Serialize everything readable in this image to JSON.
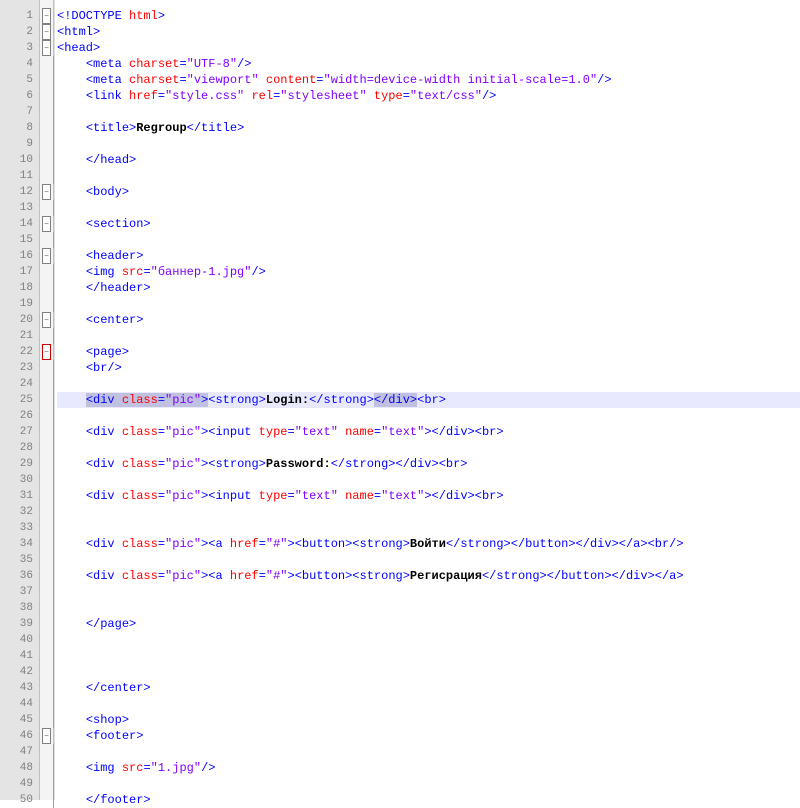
{
  "tabs": {
    "active": "..."
  },
  "gutter": {
    "start": 1,
    "end": 50
  },
  "foldMarkers": {
    "1": "minus",
    "2": "minus",
    "3": "minus",
    "12": "minus",
    "14": "minus",
    "16": "minus",
    "20": "minus",
    "22": "minus-red",
    "46": "minus"
  },
  "code": {
    "1": {
      "indent": 0,
      "tokens": [
        {
          "t": "tag",
          "v": "<!DOCTYPE "
        },
        {
          "t": "attr",
          "v": "html"
        },
        {
          "t": "tag",
          "v": ">"
        }
      ]
    },
    "2": {
      "indent": 0,
      "tokens": [
        {
          "t": "tag",
          "v": "<html>"
        }
      ]
    },
    "3": {
      "indent": 0,
      "tokens": [
        {
          "t": "tag",
          "v": "<head>"
        }
      ]
    },
    "4": {
      "indent": 1,
      "tokens": [
        {
          "t": "tag",
          "v": "<meta "
        },
        {
          "t": "attr",
          "v": "charset"
        },
        {
          "t": "tag",
          "v": "="
        },
        {
          "t": "val",
          "v": "\"UTF-8\""
        },
        {
          "t": "tag",
          "v": "/>"
        }
      ]
    },
    "5": {
      "indent": 1,
      "tokens": [
        {
          "t": "tag",
          "v": "<meta "
        },
        {
          "t": "attr",
          "v": "charset"
        },
        {
          "t": "tag",
          "v": "="
        },
        {
          "t": "val",
          "v": "\"viewport\""
        },
        {
          "t": "tag",
          "v": " "
        },
        {
          "t": "attr",
          "v": "content"
        },
        {
          "t": "tag",
          "v": "="
        },
        {
          "t": "val",
          "v": "\"width=device-width initial-scale=1.0\""
        },
        {
          "t": "tag",
          "v": "/>"
        }
      ]
    },
    "6": {
      "indent": 1,
      "tokens": [
        {
          "t": "tag",
          "v": "<link "
        },
        {
          "t": "attr",
          "v": "href"
        },
        {
          "t": "tag",
          "v": "="
        },
        {
          "t": "val",
          "v": "\"style.css\""
        },
        {
          "t": "tag",
          "v": " "
        },
        {
          "t": "attr",
          "v": "rel"
        },
        {
          "t": "tag",
          "v": "="
        },
        {
          "t": "val",
          "v": "\"stylesheet\""
        },
        {
          "t": "tag",
          "v": " "
        },
        {
          "t": "attr",
          "v": "type"
        },
        {
          "t": "tag",
          "v": "="
        },
        {
          "t": "val",
          "v": "\"text/css\""
        },
        {
          "t": "tag",
          "v": "/>"
        }
      ]
    },
    "7": {
      "indent": 1,
      "tokens": []
    },
    "8": {
      "indent": 1,
      "tokens": [
        {
          "t": "tag",
          "v": "<title>"
        },
        {
          "t": "txt",
          "v": "Regroup"
        },
        {
          "t": "tag",
          "v": "</title>"
        }
      ]
    },
    "9": {
      "indent": 1,
      "tokens": []
    },
    "10": {
      "indent": 1,
      "tokens": [
        {
          "t": "tag",
          "v": "</head>"
        }
      ]
    },
    "11": {
      "indent": 1,
      "tokens": []
    },
    "12": {
      "indent": 1,
      "tokens": [
        {
          "t": "tag",
          "v": "<body>"
        }
      ]
    },
    "13": {
      "indent": 1,
      "tokens": []
    },
    "14": {
      "indent": 1,
      "tokens": [
        {
          "t": "tag",
          "v": "<section>"
        }
      ]
    },
    "15": {
      "indent": 1,
      "tokens": []
    },
    "16": {
      "indent": 1,
      "tokens": [
        {
          "t": "tag",
          "v": "<header>"
        }
      ]
    },
    "17": {
      "indent": 1,
      "tokens": [
        {
          "t": "tag",
          "v": "<img "
        },
        {
          "t": "attr",
          "v": "src"
        },
        {
          "t": "tag",
          "v": "="
        },
        {
          "t": "val",
          "v": "\"баннер-1.jpg\""
        },
        {
          "t": "tag",
          "v": "/>"
        }
      ]
    },
    "18": {
      "indent": 1,
      "tokens": [
        {
          "t": "tag",
          "v": "</header>"
        }
      ]
    },
    "19": {
      "indent": 1,
      "tokens": []
    },
    "20": {
      "indent": 1,
      "tokens": [
        {
          "t": "tag",
          "v": "<center>"
        }
      ]
    },
    "21": {
      "indent": 1,
      "tokens": []
    },
    "22": {
      "indent": 1,
      "tokens": [
        {
          "t": "tag",
          "v": "<page>"
        }
      ]
    },
    "23": {
      "indent": 1,
      "tokens": [
        {
          "t": "tag",
          "v": "<br/>"
        }
      ]
    },
    "24": {
      "indent": 1,
      "tokens": []
    },
    "25": {
      "indent": 1,
      "hl": true,
      "tokens": [
        {
          "t": "sel",
          "inner": [
            {
              "t": "tag",
              "v": "<div "
            },
            {
              "t": "attr",
              "v": "class"
            },
            {
              "t": "tag",
              "v": "="
            },
            {
              "t": "val",
              "v": "\"pic\""
            },
            {
              "t": "tag",
              "v": ">"
            }
          ]
        },
        {
          "t": "tag",
          "v": "<strong>"
        },
        {
          "t": "txt",
          "v": "Login:"
        },
        {
          "t": "tag",
          "v": "</strong>"
        },
        {
          "t": "sel",
          "inner": [
            {
              "t": "tag",
              "v": "</div>"
            }
          ]
        },
        {
          "t": "tag",
          "v": "<br>"
        }
      ]
    },
    "26": {
      "indent": 1,
      "tokens": []
    },
    "27": {
      "indent": 1,
      "tokens": [
        {
          "t": "tag",
          "v": "<div "
        },
        {
          "t": "attr",
          "v": "class"
        },
        {
          "t": "tag",
          "v": "="
        },
        {
          "t": "val",
          "v": "\"pic\""
        },
        {
          "t": "tag",
          "v": "><input "
        },
        {
          "t": "attr",
          "v": "type"
        },
        {
          "t": "tag",
          "v": "="
        },
        {
          "t": "val",
          "v": "\"text\""
        },
        {
          "t": "tag",
          "v": " "
        },
        {
          "t": "attr",
          "v": "name"
        },
        {
          "t": "tag",
          "v": "="
        },
        {
          "t": "val",
          "v": "\"text\""
        },
        {
          "t": "tag",
          "v": "></div><br>"
        }
      ]
    },
    "28": {
      "indent": 1,
      "tokens": []
    },
    "29": {
      "indent": 1,
      "tokens": [
        {
          "t": "tag",
          "v": "<div "
        },
        {
          "t": "attr",
          "v": "class"
        },
        {
          "t": "tag",
          "v": "="
        },
        {
          "t": "val",
          "v": "\"pic\""
        },
        {
          "t": "tag",
          "v": "><strong>"
        },
        {
          "t": "txt",
          "v": "Password:"
        },
        {
          "t": "tag",
          "v": "</strong></div><br>"
        }
      ]
    },
    "30": {
      "indent": 1,
      "tokens": []
    },
    "31": {
      "indent": 1,
      "tokens": [
        {
          "t": "tag",
          "v": "<div "
        },
        {
          "t": "attr",
          "v": "class"
        },
        {
          "t": "tag",
          "v": "="
        },
        {
          "t": "val",
          "v": "\"pic\""
        },
        {
          "t": "tag",
          "v": "><input "
        },
        {
          "t": "attr",
          "v": "type"
        },
        {
          "t": "tag",
          "v": "="
        },
        {
          "t": "val",
          "v": "\"text\""
        },
        {
          "t": "tag",
          "v": " "
        },
        {
          "t": "attr",
          "v": "name"
        },
        {
          "t": "tag",
          "v": "="
        },
        {
          "t": "val",
          "v": "\"text\""
        },
        {
          "t": "tag",
          "v": "></div><br>"
        }
      ]
    },
    "32": {
      "indent": 1,
      "tokens": []
    },
    "33": {
      "indent": 1,
      "tokens": []
    },
    "34": {
      "indent": 1,
      "tokens": [
        {
          "t": "tag",
          "v": "<div "
        },
        {
          "t": "attr",
          "v": "class"
        },
        {
          "t": "tag",
          "v": "="
        },
        {
          "t": "val",
          "v": "\"pic\""
        },
        {
          "t": "tag",
          "v": "><a "
        },
        {
          "t": "attr",
          "v": "href"
        },
        {
          "t": "tag",
          "v": "="
        },
        {
          "t": "val",
          "v": "\"#\""
        },
        {
          "t": "tag",
          "v": "><button><strong>"
        },
        {
          "t": "txt",
          "v": "Войти"
        },
        {
          "t": "tag",
          "v": "</strong></button></div></a><br/>"
        }
      ]
    },
    "35": {
      "indent": 1,
      "tokens": []
    },
    "36": {
      "indent": 1,
      "tokens": [
        {
          "t": "tag",
          "v": "<div "
        },
        {
          "t": "attr",
          "v": "class"
        },
        {
          "t": "tag",
          "v": "="
        },
        {
          "t": "val",
          "v": "\"pic\""
        },
        {
          "t": "tag",
          "v": "><a "
        },
        {
          "t": "attr",
          "v": "href"
        },
        {
          "t": "tag",
          "v": "="
        },
        {
          "t": "val",
          "v": "\"#\""
        },
        {
          "t": "tag",
          "v": "><button><strong>"
        },
        {
          "t": "txt",
          "v": "Регисрация"
        },
        {
          "t": "tag",
          "v": "</strong></button></div></a>"
        }
      ]
    },
    "37": {
      "indent": 1,
      "tokens": []
    },
    "38": {
      "indent": 1,
      "tokens": []
    },
    "39": {
      "indent": 1,
      "tokens": [
        {
          "t": "tag",
          "v": "</page>"
        }
      ]
    },
    "40": {
      "indent": 1,
      "tokens": []
    },
    "41": {
      "indent": 1,
      "tokens": []
    },
    "42": {
      "indent": 1,
      "tokens": []
    },
    "43": {
      "indent": 1,
      "tokens": [
        {
          "t": "tag",
          "v": "</center>"
        }
      ]
    },
    "44": {
      "indent": 1,
      "tokens": []
    },
    "45": {
      "indent": 1,
      "tokens": [
        {
          "t": "tag",
          "v": "<shop>"
        }
      ]
    },
    "46": {
      "indent": 1,
      "tokens": [
        {
          "t": "tag",
          "v": "<footer>"
        }
      ]
    },
    "47": {
      "indent": 1,
      "tokens": []
    },
    "48": {
      "indent": 1,
      "tokens": [
        {
          "t": "tag",
          "v": "<img "
        },
        {
          "t": "attr",
          "v": "src"
        },
        {
          "t": "tag",
          "v": "="
        },
        {
          "t": "val",
          "v": "\"1.jpg\""
        },
        {
          "t": "tag",
          "v": "/>"
        }
      ]
    },
    "49": {
      "indent": 1,
      "tokens": []
    },
    "50": {
      "indent": 1,
      "tokens": [
        {
          "t": "tag",
          "v": "</footer>"
        }
      ]
    }
  }
}
